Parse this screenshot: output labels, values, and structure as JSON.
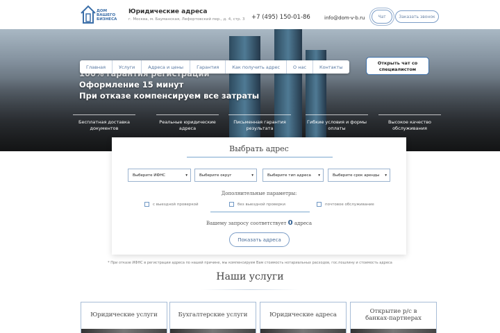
{
  "header": {
    "logo_text": "ДОМ ВАШЕГО БИЗНЕСА",
    "title": "Юридические адреса",
    "address": "г. Москва, м. Бауманская, Лефортовский пер., д. 4, стр. 3",
    "phone": "+7 (495) 150-01-86",
    "email": "info@dom-v-b.ru",
    "chat_label": "Чат",
    "callback_label": "Заказать звонок"
  },
  "nav": [
    "Главная",
    "Услуги",
    "Адреса и цены",
    "Гарантия",
    "Как получить адрес",
    "О нас",
    "Контакты"
  ],
  "chat_bubble": "Открыть чат со специалистом",
  "hero": {
    "line1": "100% гарантия регистрации",
    "line2": "Оформление 15 минут",
    "line3": "При отказе компенсируем все затраты"
  },
  "features": [
    "Бесплатная доставка документов",
    "Реальные юридические адреса",
    "Письменная гарантия результата",
    "Гибкие условия и формы оплаты",
    "Высокое качество обслуживания"
  ],
  "search": {
    "title": "Выбрать адрес",
    "selects": [
      "Выберите ИФНС",
      "Выберите округ",
      "Выберите тип адреса",
      "Выберите срок аренды"
    ],
    "additional_label": "Дополнительные параметры:",
    "checkboxes": [
      "с выездной проверкой",
      "без выездной проверки",
      "почтовое обслуживание"
    ],
    "result_prefix": "Вашему запросу соответствует",
    "result_count": "0",
    "result_suffix": "адреса",
    "button": "Показать адреса"
  },
  "footnote": "* При отказе ИФНС в регистрации адреса по нашей причине, мы компенсируем Вам стоимость нотариальных расходов, гос.пошлину и стоимость адреса",
  "services": {
    "title": "Наши услуги",
    "cards": [
      "Юридические услуги",
      "Бухгалтерские услуги",
      "Юридические адреса",
      "Открытие р/с в банках-партнерах"
    ]
  }
}
